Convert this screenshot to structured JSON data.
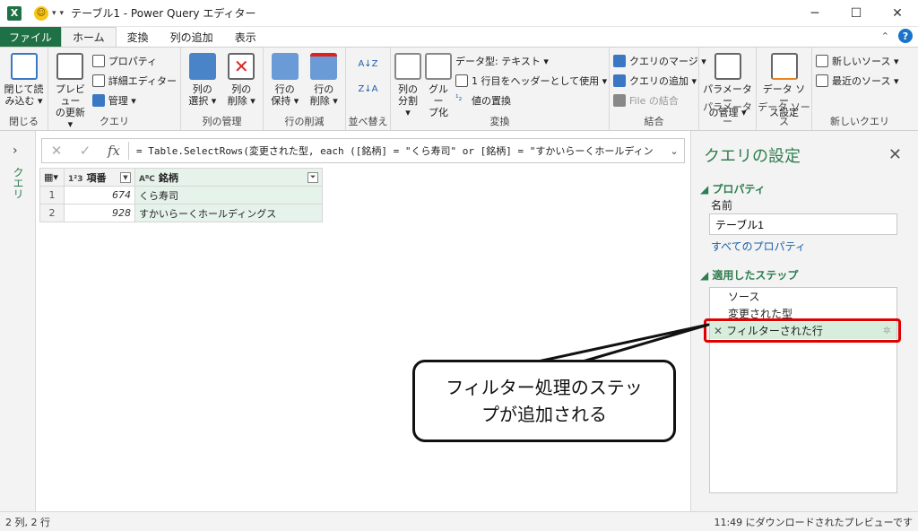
{
  "window": {
    "title": "テーブル1 - Power Query エディター",
    "app_icon": "X"
  },
  "tabs": [
    {
      "label": "ファイル"
    },
    {
      "label": "ホーム"
    },
    {
      "label": "変換"
    },
    {
      "label": "列の追加"
    },
    {
      "label": "表示"
    }
  ],
  "ribbon": {
    "close": {
      "button": "閉じて読\nみ込む ▾",
      "group": "閉じる"
    },
    "query": {
      "preview": "プレビュー\nの更新 ▾",
      "properties": "プロパティ",
      "advanced_editor": "詳細エディター",
      "manage": "管理 ▾",
      "group": "クエリ"
    },
    "manage_columns": {
      "choose": "列の\n選択 ▾",
      "remove": "列の\n削除 ▾",
      "group": "列の管理"
    },
    "reduce_rows": {
      "keep": "行の\n保持 ▾",
      "remove": "行の\n削除 ▾",
      "group": "行の削減"
    },
    "sort": {
      "asc": "A↓Z",
      "desc": "Z↓A",
      "group": "並べ替え"
    },
    "transform": {
      "split": "列の\n分割 ▾",
      "group_by": "グルー\nプ化",
      "data_type": "データ型: テキスト ▾",
      "first_row": "1 行目をヘッダーとして使用 ▾",
      "replace": "値の置換",
      "group": "変換"
    },
    "combine": {
      "merge": "クエリのマージ ▾",
      "append": "クエリの追加 ▾",
      "combine_files": "File の結合",
      "group": "結合"
    },
    "parameters": {
      "manage": "パラメーター\nの管理 ▾",
      "group": "パラメーター"
    },
    "data_sources": {
      "settings": "データ ソー\nス設定",
      "group": "データ ソース"
    },
    "new_query": {
      "new_source": "新しいソース ▾",
      "recent": "最近のソース ▾",
      "group": "新しいクエリ"
    }
  },
  "left_panel": {
    "label": "クエリ"
  },
  "formula_bar": {
    "fx": "fx",
    "formula": "= Table.SelectRows(変更された型, each ([銘柄] = \"くら寿司\" or [銘柄] = \"すかいらーくホールディン"
  },
  "table": {
    "columns": [
      {
        "type": "1²3",
        "name": "項番"
      },
      {
        "type": "AᴮC",
        "name": "銘柄"
      }
    ],
    "rows": [
      {
        "index": "1",
        "num": "674",
        "name": "くら寿司"
      },
      {
        "index": "2",
        "num": "928",
        "name": "すかいらーくホールディングス"
      }
    ]
  },
  "query_settings": {
    "title": "クエリの設定",
    "properties_header": "◢ プロパティ",
    "name_label": "名前",
    "name_value": "テーブル1",
    "all_properties": "すべてのプロパティ",
    "steps_header": "◢ 適用したステップ",
    "steps": [
      "ソース",
      "変更された型",
      "フィルターされた行"
    ]
  },
  "callout": {
    "line1": "フィルター処理のステッ",
    "line2": "プが追加される"
  },
  "status": {
    "left": "2 列, 2 行",
    "right": "11:49 にダウンロードされたプレビューです"
  },
  "colors": {
    "accent": "#1e7145",
    "highlight_red": "#e00000",
    "selected_step": "#d7eedd"
  }
}
